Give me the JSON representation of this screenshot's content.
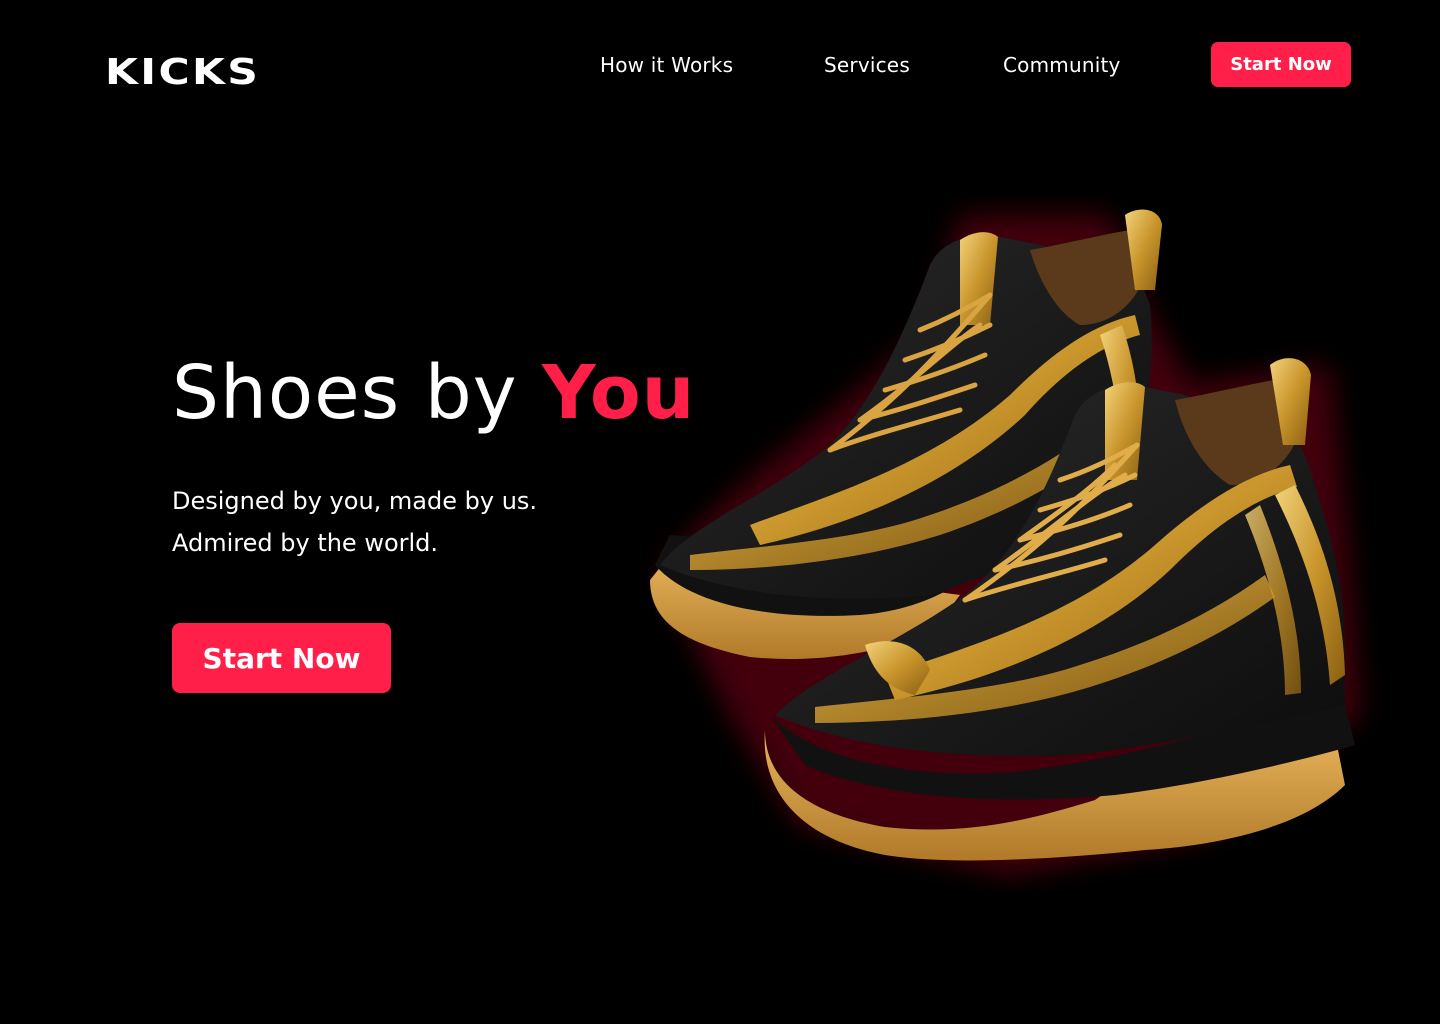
{
  "brand": {
    "logo_text": "KICKS"
  },
  "nav": {
    "items": [
      {
        "label": "How it Works"
      },
      {
        "label": "Services"
      },
      {
        "label": "Community"
      }
    ],
    "cta_label": "Start Now"
  },
  "hero": {
    "title_prefix": "Shoes by ",
    "title_accent": "You",
    "subtitle_line1": "Designed by you, made by us.",
    "subtitle_line2": "Admired by the world.",
    "cta_label": "Start Now",
    "image_icon": "sneakers-pair-image"
  },
  "colors": {
    "background": "#000000",
    "accent": "#ff1f48",
    "text": "#ffffff",
    "shoe_gold": "#d4a53a",
    "shoe_black": "#151515"
  }
}
